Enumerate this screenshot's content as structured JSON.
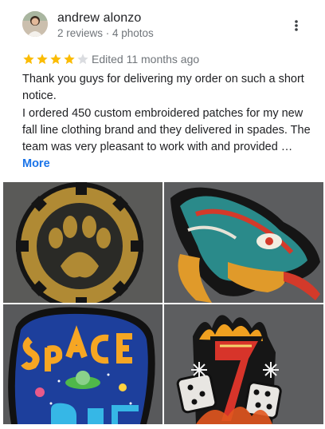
{
  "review": {
    "author": "andrew alonzo",
    "author_meta": "2 reviews · 4 photos",
    "rating": 4,
    "max_rating": 5,
    "star_color": "#fbbc04",
    "empty_star_color": "#dadce0",
    "edited": "Edited 11 months ago",
    "text_paragraph1": "Thank you guys for delivering my order on such a short notice.",
    "text_paragraph2": "I ordered 450 custom embroidered patches for my new fall line clothing brand and they delivered in spades. The team was very pleasant to work with and provided … ",
    "more_label": "More",
    "menu_icon": "more-vert-icon"
  },
  "photos": [
    {
      "name": "bear-paw-patch"
    },
    {
      "name": "serpent-patch"
    },
    {
      "name": "space-out-patch"
    },
    {
      "name": "lucky-seven-dice-patch"
    }
  ]
}
